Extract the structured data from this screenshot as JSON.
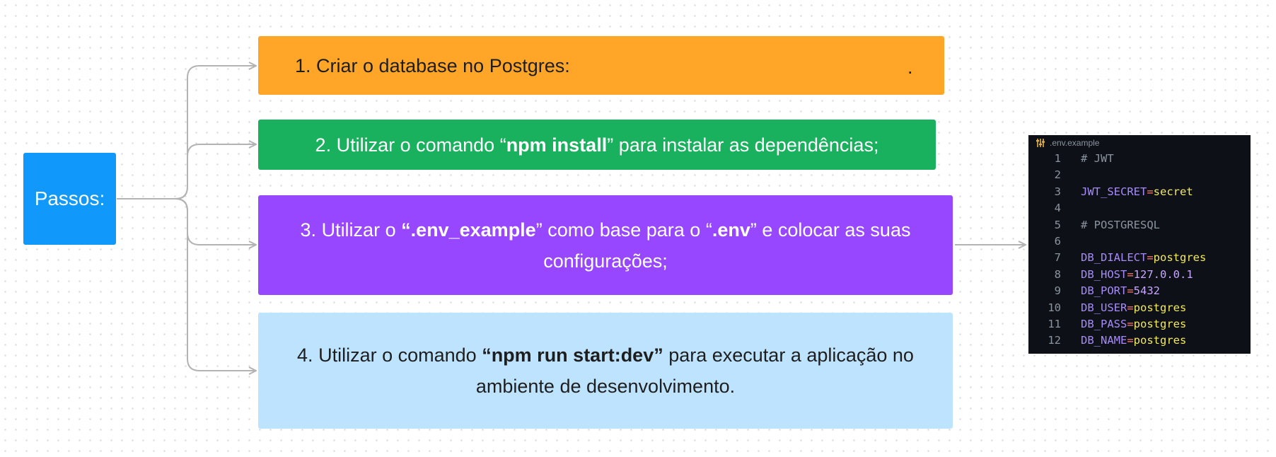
{
  "root": {
    "label": "Passos:"
  },
  "steps": {
    "s1": {
      "num": "1.",
      "pre": "Criar o database no Postgres:",
      "trail": "."
    },
    "s2": {
      "num": "2.",
      "pre": "Utilizar o comando “",
      "bold": "npm install",
      "post": "” para instalar as dependências;"
    },
    "s3": {
      "num": "3.",
      "pre": "Utilizar o ",
      "bold1": "“.env_example",
      "mid": "” como base para o “",
      "bold2": ".env",
      "post": "” e colocar as suas configurações;"
    },
    "s4": {
      "num": "4.",
      "pre": "Utilizar o comando ",
      "bold": "“npm run start:dev”",
      "post": " para executar a aplicação no ambiente de desenvolvimento."
    }
  },
  "code": {
    "filename": ".env.example",
    "icon": "settings-sliders-icon",
    "lines": [
      {
        "n": "1",
        "comment": "# JWT"
      },
      {
        "n": "2"
      },
      {
        "n": "3",
        "key": "JWT_SECRET",
        "eq": "=",
        "val": "secret"
      },
      {
        "n": "4"
      },
      {
        "n": "5",
        "comment": "# POSTGRESQL"
      },
      {
        "n": "6"
      },
      {
        "n": "7",
        "key": "DB_DIALECT",
        "eq": "=",
        "val": "postgres"
      },
      {
        "n": "8",
        "key": "DB_HOST",
        "eq": "=",
        "num": "127.0.0.1"
      },
      {
        "n": "9",
        "key": "DB_PORT",
        "eq": "=",
        "num": "5432"
      },
      {
        "n": "10",
        "key": "DB_USER",
        "eq": "=",
        "val": "postgres"
      },
      {
        "n": "11",
        "key": "DB_PASS",
        "eq": "=",
        "val": "postgres"
      },
      {
        "n": "12",
        "key": "DB_NAME",
        "eq": "=",
        "val": "postgres"
      }
    ]
  },
  "colors": {
    "root": "#1098fb",
    "step1": "#ffa629",
    "step2": "#19b05e",
    "step3": "#9747ff",
    "step4": "#bde3ff",
    "connector": "#b3b3b3",
    "code_bg": "#0d1117"
  }
}
